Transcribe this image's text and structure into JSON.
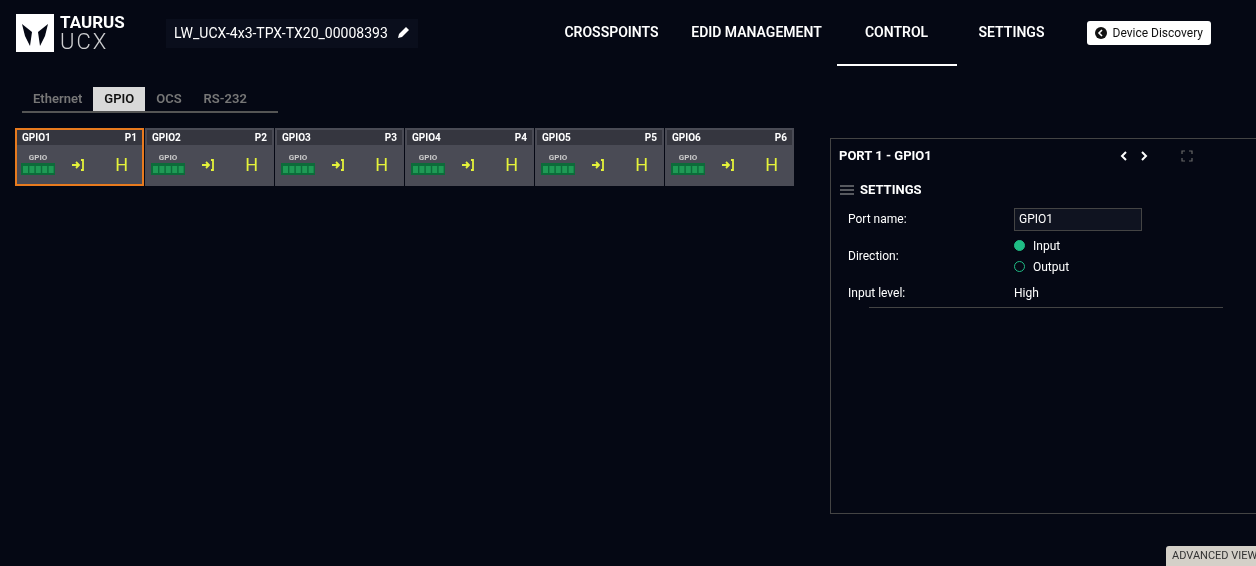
{
  "header": {
    "logo_top": "TAURUS",
    "logo_bottom": "UCX",
    "device_name": "LW_UCX-4x3-TPX-TX20_00008393",
    "nav": [
      {
        "label": "CROSSPOINTS",
        "selected": false
      },
      {
        "label": "EDID MANAGEMENT",
        "selected": false
      },
      {
        "label": "CONTROL",
        "selected": true
      },
      {
        "label": "SETTINGS",
        "selected": false
      }
    ],
    "discovery_button": "Device Discovery"
  },
  "tabs": [
    {
      "label": "Ethernet",
      "selected": false
    },
    {
      "label": "GPIO",
      "selected": true
    },
    {
      "label": "OCS",
      "selected": false
    },
    {
      "label": "RS-232",
      "selected": false
    }
  ],
  "ports": [
    {
      "name": "GPIO1",
      "port": "P1",
      "connector": "GPIO",
      "level": "H",
      "selected": true
    },
    {
      "name": "GPIO2",
      "port": "P2",
      "connector": "GPIO",
      "level": "H",
      "selected": false
    },
    {
      "name": "GPIO3",
      "port": "P3",
      "connector": "GPIO",
      "level": "H",
      "selected": false
    },
    {
      "name": "GPIO4",
      "port": "P4",
      "connector": "GPIO",
      "level": "H",
      "selected": false
    },
    {
      "name": "GPIO5",
      "port": "P5",
      "connector": "GPIO",
      "level": "H",
      "selected": false
    },
    {
      "name": "GPIO6",
      "port": "P6",
      "connector": "GPIO",
      "level": "H",
      "selected": false
    }
  ],
  "panel": {
    "title": "PORT 1 - GPIO1",
    "section": "SETTINGS",
    "port_name_label": "Port name:",
    "port_name_value": "GPIO1",
    "direction_label": "Direction:",
    "direction_options": [
      {
        "label": "Input",
        "selected": true
      },
      {
        "label": "Output",
        "selected": false
      }
    ],
    "input_level_label": "Input level:",
    "input_level_value": "High"
  },
  "advanced_view": "ADVANCED VIEW"
}
